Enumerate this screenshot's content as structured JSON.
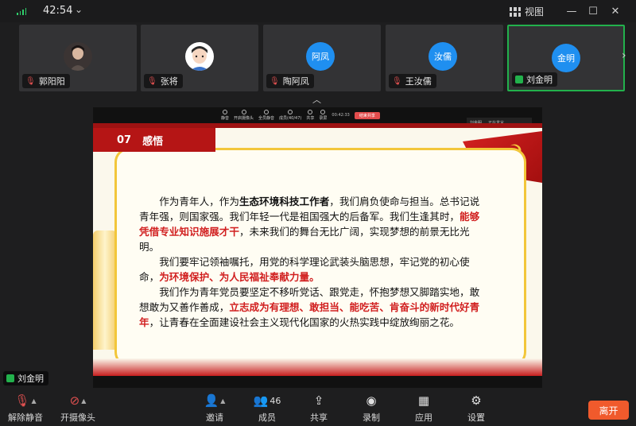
{
  "titlebar": {
    "timer": "42:54",
    "view_label": "视图"
  },
  "participants": [
    {
      "name": "郭阳阳",
      "type": "photo"
    },
    {
      "name": "张将",
      "type": "photo"
    },
    {
      "name": "陶阿凤",
      "avatar_text": "阿凤"
    },
    {
      "name": "王汝儒",
      "avatar_text": "汝儒"
    },
    {
      "name": "刘金明",
      "avatar_text": "金明",
      "active": true
    }
  ],
  "share": {
    "mini_toolbar": [
      "静音",
      "开启摄像头",
      "全员静音",
      "成员(40/47)",
      "共享",
      "录屏"
    ],
    "mini_time": "00:42:33",
    "mini_end": "结束共享",
    "speaker_label": "刘金明",
    "speaker_status": "正在发言"
  },
  "slide": {
    "section_no": "07",
    "section_title": "感悟",
    "paragraphs": [
      [
        {
          "t": "作为青年人，作为"
        },
        {
          "t": "生态环境科技工作者",
          "s": "b"
        },
        {
          "t": "，我们肩负使命与担当。总书记说青年强，则国家强。我们年轻一代是祖国强大的后备军。我们生逢其时，"
        },
        {
          "t": "能够凭借专业知识施展才干",
          "s": "r"
        },
        {
          "t": "，未来我们的舞台无比广阔，实现梦想的前景无比光明。"
        }
      ],
      [
        {
          "t": "我们要牢记领袖嘱托，用党的科学理论武装头脑思想，牢记党的初心使命，"
        },
        {
          "t": "为环境保护、为人民福祉奉献力量。",
          "s": "r"
        }
      ],
      [
        {
          "t": "我们作为青年党员要坚定不移听党话、跟党走，怀抱梦想又脚踏实地，敢想敢为又善作善成，"
        },
        {
          "t": "立志成为有理想、敢担当、能吃苦、肯奋斗的新时代好青年",
          "s": "r"
        },
        {
          "t": "，让青春在全面建设社会主义现代化国家的火热实践中绽放绚丽之花。"
        }
      ]
    ]
  },
  "self_nameplate": "刘金明",
  "toolbar": {
    "unmute": "解除静音",
    "camera": "开摄像头",
    "invite": "邀请",
    "members": "成员",
    "members_count": "46",
    "share": "共享",
    "record": "录制",
    "apps": "应用",
    "settings": "设置",
    "leave": "离开"
  },
  "colors": {
    "accent_green": "#22b14c",
    "avatar_blue": "#1f8ff0",
    "leave_orange": "#f05a2c",
    "slide_red": "#d11f1f"
  }
}
